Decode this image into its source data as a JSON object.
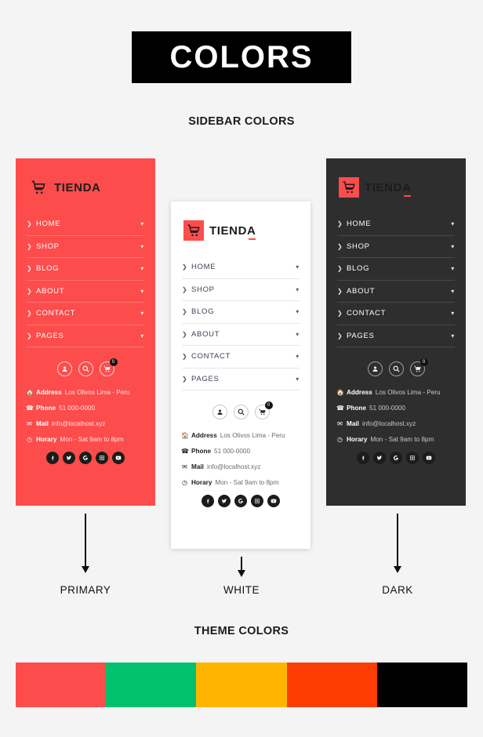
{
  "header": {
    "title": "COLORS"
  },
  "sections": {
    "sidebar_colors_label": "SIDEBAR COLORS",
    "theme_colors_label": "THEME COLORS"
  },
  "brand": {
    "name": "TIENDA",
    "logo_icon": "shopping-cart-icon"
  },
  "menu_items": [
    {
      "label": "HOME"
    },
    {
      "label": "SHOP"
    },
    {
      "label": "BLOG"
    },
    {
      "label": "ABOUT"
    },
    {
      "label": "CONTACT"
    },
    {
      "label": "PAGES"
    }
  ],
  "actions": [
    {
      "name": "account-icon",
      "icon": "user-icon"
    },
    {
      "name": "search-icon",
      "icon": "search-icon"
    },
    {
      "name": "cart-icon",
      "icon": "cart-icon",
      "badge": "0"
    }
  ],
  "contact": [
    {
      "icon": "home-icon",
      "key": "Address",
      "value": "Los Olivos Lima - Peru"
    },
    {
      "icon": "phone-icon",
      "key": "Phone",
      "value": "51 000-0000"
    },
    {
      "icon": "mail-icon",
      "key": "Mail",
      "value": "info@localhost.xyz"
    },
    {
      "icon": "clock-icon",
      "key": "Horary",
      "value": "Mon - Sat 9am to 8pm"
    }
  ],
  "social": [
    {
      "name": "facebook-icon"
    },
    {
      "name": "twitter-icon"
    },
    {
      "name": "google-icon"
    },
    {
      "name": "instagram-icon"
    },
    {
      "name": "youtube-icon"
    }
  ],
  "variants": [
    {
      "caption": "PRIMARY",
      "bg": "#fd4c4c"
    },
    {
      "caption": "WHITE",
      "bg": "#ffffff"
    },
    {
      "caption": "DARK",
      "bg": "#2e2e2e"
    }
  ],
  "theme_colors": [
    {
      "name": "primary-red",
      "hex": "#fd4c4c"
    },
    {
      "name": "green",
      "hex": "#00c16e"
    },
    {
      "name": "amber",
      "hex": "#ffb400"
    },
    {
      "name": "orange",
      "hex": "#fc3d03"
    },
    {
      "name": "black",
      "hex": "#000000"
    }
  ]
}
